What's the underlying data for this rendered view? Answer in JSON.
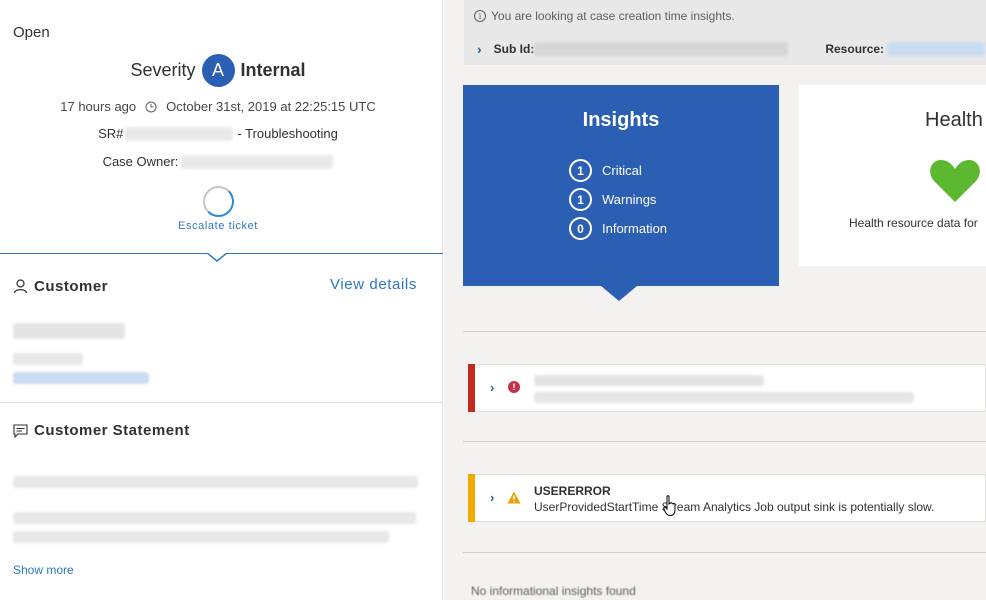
{
  "case": {
    "status": "Open",
    "severity_label": "Severity",
    "severity_badge": "A",
    "severity_type": "Internal",
    "relative_time": "17 hours ago",
    "created_time": "October 31st, 2019 at 22:25:15 UTC",
    "sr_label": "SR#",
    "sr_suffix": "- Troubleshooting",
    "owner_label": "Case Owner:",
    "escalate_label": "Escalate ticket"
  },
  "customer": {
    "title": "Customer",
    "view_details": "View details"
  },
  "statement": {
    "title": "Customer Statement",
    "show_more": "Show more"
  },
  "info_bar": {
    "message": "You are looking at case creation time insights.",
    "sub_id_label": "Sub Id:",
    "resource_label": "Resource:"
  },
  "insights": {
    "title": "Insights",
    "items": [
      {
        "count": "1",
        "label": "Critical"
      },
      {
        "count": "1",
        "label": "Warnings"
      },
      {
        "count": "0",
        "label": "Information"
      }
    ]
  },
  "health": {
    "title": "Health",
    "text": "Health resource data for",
    "heart_color": "#5cb82e"
  },
  "cards": [
    {
      "type": "critical",
      "stripe_color": "#c42b1c"
    },
    {
      "type": "warning",
      "stripe_color": "#f2a900",
      "title": "USERERROR",
      "description": "UserProvidedStartTime Stream Analytics Job output sink is potentially slow."
    }
  ],
  "bottom_text": "No informational insights found"
}
